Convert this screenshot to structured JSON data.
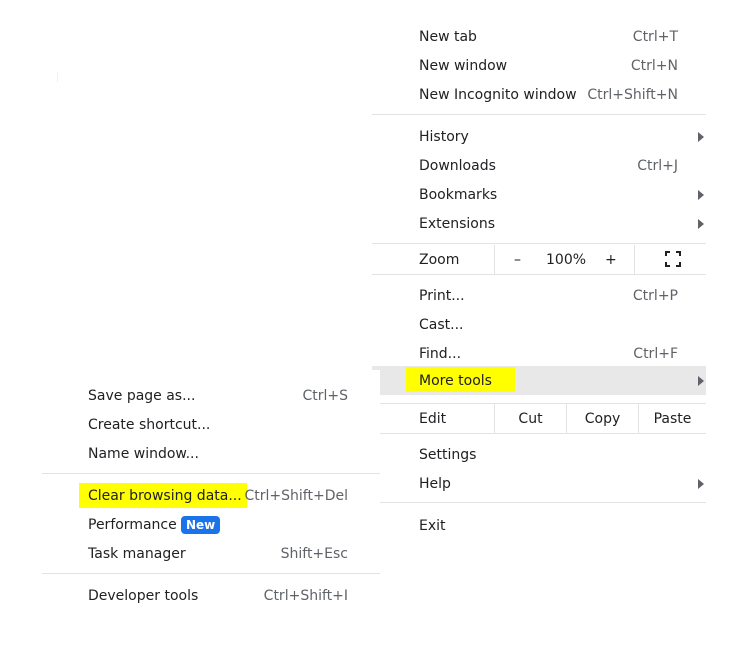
{
  "main_menu": {
    "new_tab": {
      "label": "New tab",
      "shortcut": "Ctrl+T"
    },
    "new_window": {
      "label": "New window",
      "shortcut": "Ctrl+N"
    },
    "new_incognito": {
      "label": "New Incognito window",
      "shortcut": "Ctrl+Shift+N"
    },
    "history": {
      "label": "History"
    },
    "downloads": {
      "label": "Downloads",
      "shortcut": "Ctrl+J"
    },
    "bookmarks": {
      "label": "Bookmarks"
    },
    "extensions": {
      "label": "Extensions"
    },
    "zoom": {
      "label": "Zoom",
      "minus": "–",
      "level": "100%",
      "plus": "+"
    },
    "print": {
      "label": "Print...",
      "shortcut": "Ctrl+P"
    },
    "cast": {
      "label": "Cast..."
    },
    "find": {
      "label": "Find...",
      "shortcut": "Ctrl+F"
    },
    "more_tools": {
      "label": "More tools"
    },
    "edit": {
      "label": "Edit",
      "cut": "Cut",
      "copy": "Copy",
      "paste": "Paste"
    },
    "settings": {
      "label": "Settings"
    },
    "help": {
      "label": "Help"
    },
    "exit": {
      "label": "Exit"
    }
  },
  "more_tools_menu": {
    "save_page": {
      "label": "Save page as...",
      "shortcut": "Ctrl+S"
    },
    "create_shortcut": {
      "label": "Create shortcut..."
    },
    "name_window": {
      "label": "Name window..."
    },
    "clear_browsing": {
      "label": "Clear browsing data...",
      "shortcut": "Ctrl+Shift+Del"
    },
    "performance": {
      "label": "Performance",
      "badge": "New"
    },
    "task_manager": {
      "label": "Task manager",
      "shortcut": "Shift+Esc"
    },
    "developer_tools": {
      "label": "Developer tools",
      "shortcut": "Ctrl+Shift+I"
    }
  },
  "colors": {
    "highlight": "#ffff00",
    "hover": "#e8e8e8",
    "badge": "#1a73e8"
  }
}
